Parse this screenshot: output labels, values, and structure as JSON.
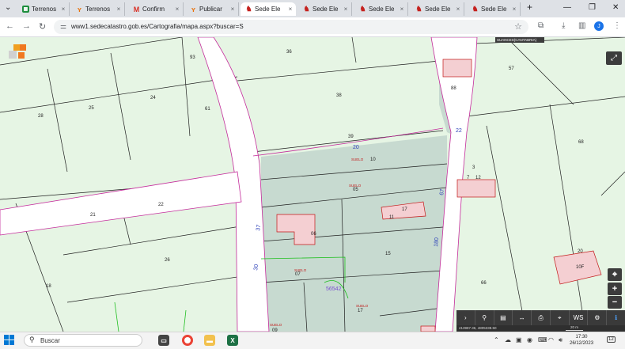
{
  "browser": {
    "tabs": [
      {
        "icon": "sheets-icon",
        "label": "Terrenos"
      },
      {
        "icon": "idealista-icon",
        "label": "Terrenos"
      },
      {
        "icon": "gmail-icon",
        "label": "Confirm"
      },
      {
        "icon": "idealista-icon",
        "label": "Publicar"
      },
      {
        "icon": "catastro-icon",
        "label": "Sede Ele"
      },
      {
        "icon": "catastro-icon",
        "label": "Sede Ele"
      },
      {
        "icon": "catastro-icon",
        "label": "Sede Ele"
      },
      {
        "icon": "catastro-icon",
        "label": "Sede Ele"
      },
      {
        "icon": "catastro-icon",
        "label": "Sede Ele"
      }
    ],
    "url": "www1.sedecatastro.gob.es/Cartografia/mapa.aspx?buscar=S",
    "profile_initial": "J"
  },
  "map": {
    "municipality": "SUANCES(CANTABRIA)",
    "plot_numbers": [
      "36",
      "93",
      "25",
      "28",
      "24",
      "61",
      "38",
      "39",
      "10",
      "05",
      "21",
      "22",
      "06",
      "11",
      "26",
      "15",
      "18",
      "07",
      "17",
      "09",
      "57",
      "68",
      "88",
      "12",
      "7",
      "17",
      "3",
      "66",
      "20",
      "10F"
    ],
    "street_labels": [
      "30",
      "20",
      "22",
      "67",
      "180",
      "37",
      "56542"
    ],
    "building_labels": [
      "SUELO",
      "SUELO",
      "SUELO",
      "SUELO",
      "SUELO"
    ],
    "toolbar": [
      {
        "icon": "chevron-right-icon",
        "label": "›"
      },
      {
        "icon": "search-icon",
        "label": "⚲"
      },
      {
        "icon": "layers-icon",
        "label": "▤"
      },
      {
        "icon": "measure-icon",
        "label": "↔"
      },
      {
        "icon": "print-icon",
        "label": "⎙"
      },
      {
        "icon": "location-icon",
        "label": "⌖"
      },
      {
        "icon": "wms-icon",
        "label": "WS"
      },
      {
        "icon": "share-icon",
        "label": "⚙"
      },
      {
        "icon": "info-icon",
        "label": "ℹ"
      }
    ],
    "coordinates": "413987.36, 4805338.50",
    "scale": "20 m"
  },
  "taskbar": {
    "search_placeholder": "Buscar",
    "time": "17:30",
    "date": "26/12/2023",
    "notification_count": "12"
  }
}
